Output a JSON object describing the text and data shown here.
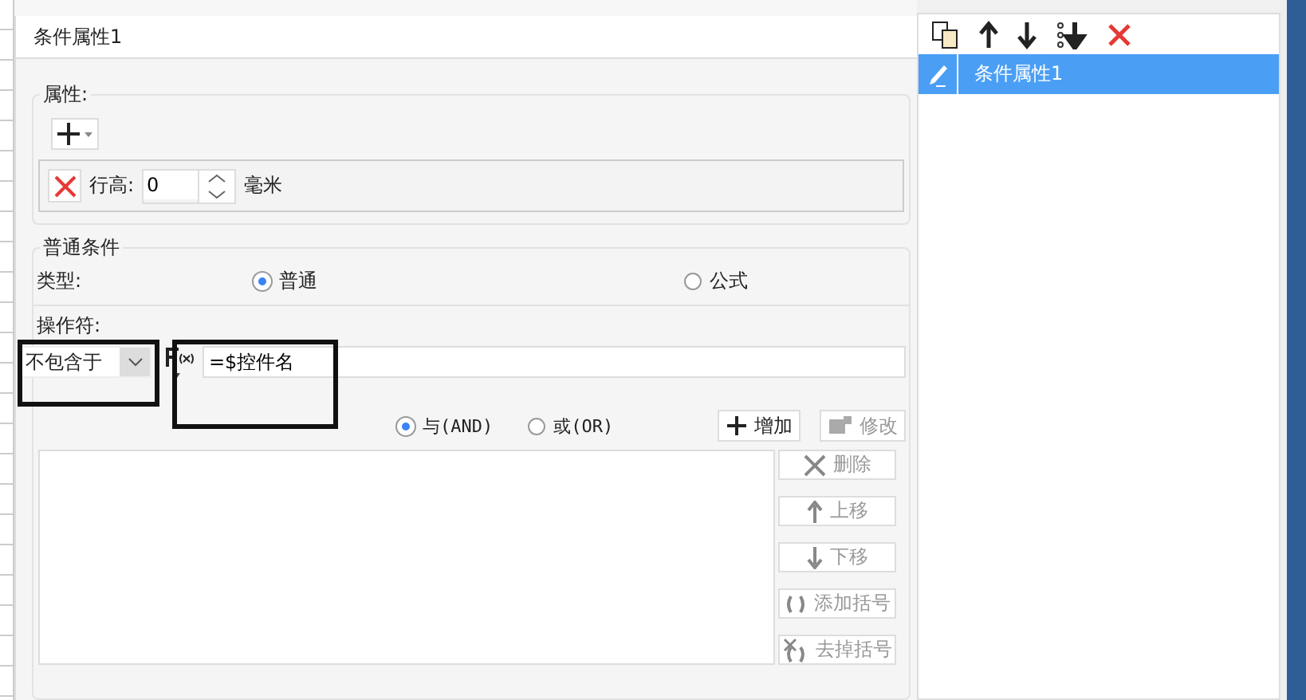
{
  "dialog": {
    "title": "条件属性1"
  },
  "properties": {
    "legend": "属性:",
    "row": {
      "label": "行高:",
      "value": "0",
      "unit": "毫米"
    }
  },
  "condition": {
    "legend": "普通条件",
    "type_label": "类型:",
    "types": [
      {
        "label": "普通",
        "selected": true
      },
      {
        "label": "公式",
        "selected": false
      }
    ],
    "operator_label": "操作符:",
    "operator": "不包含于",
    "value": "=$控件名",
    "joins": [
      {
        "label": "与(AND)",
        "selected": true
      },
      {
        "label": "或(OR)",
        "selected": false
      }
    ],
    "add_button": {
      "label": "增加",
      "disabled": false
    },
    "edit_button": {
      "label": "修改",
      "disabled": true
    },
    "side_buttons": [
      {
        "kind": "delete",
        "label": "删除",
        "disabled": true
      },
      {
        "kind": "up",
        "label": "上移",
        "disabled": true
      },
      {
        "kind": "down",
        "label": "下移",
        "disabled": true
      },
      {
        "kind": "paren",
        "label": "添加括号",
        "disabled": true
      },
      {
        "kind": "unparen",
        "label": "去掉括号",
        "disabled": true
      }
    ]
  },
  "list": {
    "items": [
      {
        "label": "条件属性1",
        "selected": true
      }
    ]
  }
}
